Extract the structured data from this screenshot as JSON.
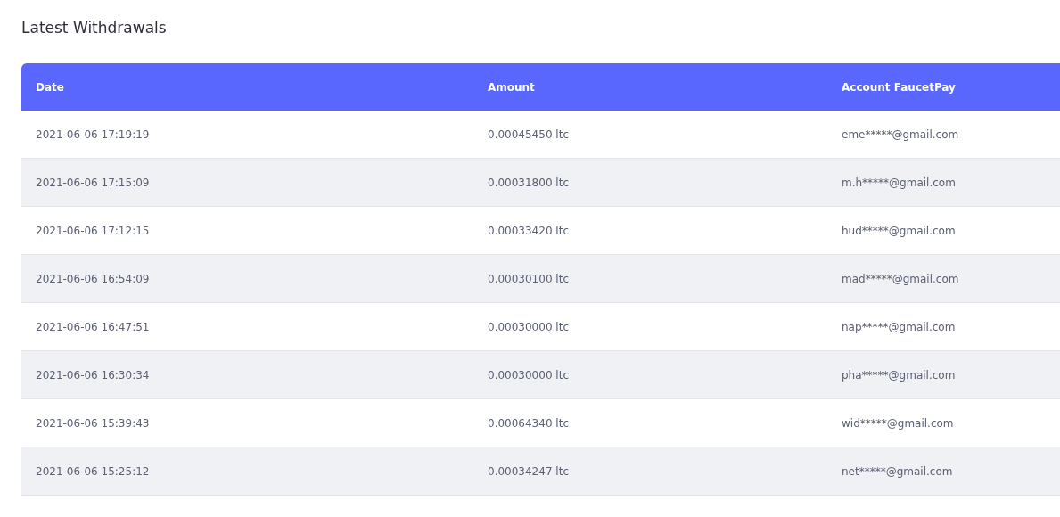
{
  "title": "Latest Withdrawals",
  "table": {
    "columns": [
      "Date",
      "Amount",
      "Account FaucetPay"
    ],
    "rows": [
      {
        "cells": [
          "2021-06-06 17:19:19",
          "0.00045450 ltc",
          "eme*****@gmail.com"
        ]
      },
      {
        "cells": [
          "2021-06-06 17:15:09",
          "0.00031800 ltc",
          "m.h*****@gmail.com"
        ]
      },
      {
        "cells": [
          "2021-06-06 17:12:15",
          "0.00033420 ltc",
          "hud*****@gmail.com"
        ]
      },
      {
        "cells": [
          "2021-06-06 16:54:09",
          "0.00030100 ltc",
          "mad*****@gmail.com"
        ]
      },
      {
        "cells": [
          "2021-06-06 16:47:51",
          "0.00030000 ltc",
          "nap*****@gmail.com"
        ]
      },
      {
        "cells": [
          "2021-06-06 16:30:34",
          "0.00030000 ltc",
          "pha*****@gmail.com"
        ]
      },
      {
        "cells": [
          "2021-06-06 15:39:43",
          "0.00064340 ltc",
          "wid*****@gmail.com"
        ]
      },
      {
        "cells": [
          "2021-06-06 15:25:12",
          "0.00034247 ltc",
          "net*****@gmail.com"
        ]
      }
    ]
  }
}
